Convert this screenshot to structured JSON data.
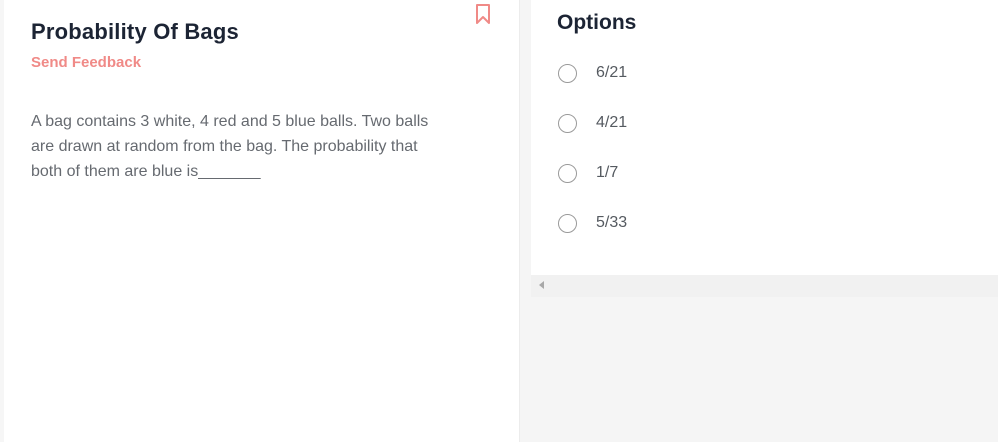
{
  "question": {
    "title": "Probability Of Bags",
    "feedback_label": "Send Feedback",
    "text": "A bag contains 3 white, 4 red and 5 blue balls. Two balls are drawn at random from the bag. The probability that both of them are blue is_______",
    "bookmark_icon": "bookmark-icon"
  },
  "options_panel": {
    "title": "Options",
    "options": [
      {
        "label": "6/21",
        "selected": false
      },
      {
        "label": "4/21",
        "selected": false
      },
      {
        "label": "1/7",
        "selected": false
      },
      {
        "label": "5/33",
        "selected": false
      }
    ]
  },
  "colors": {
    "accent": "#f08a87",
    "heading": "#1c2434",
    "body_text": "#666a70"
  }
}
